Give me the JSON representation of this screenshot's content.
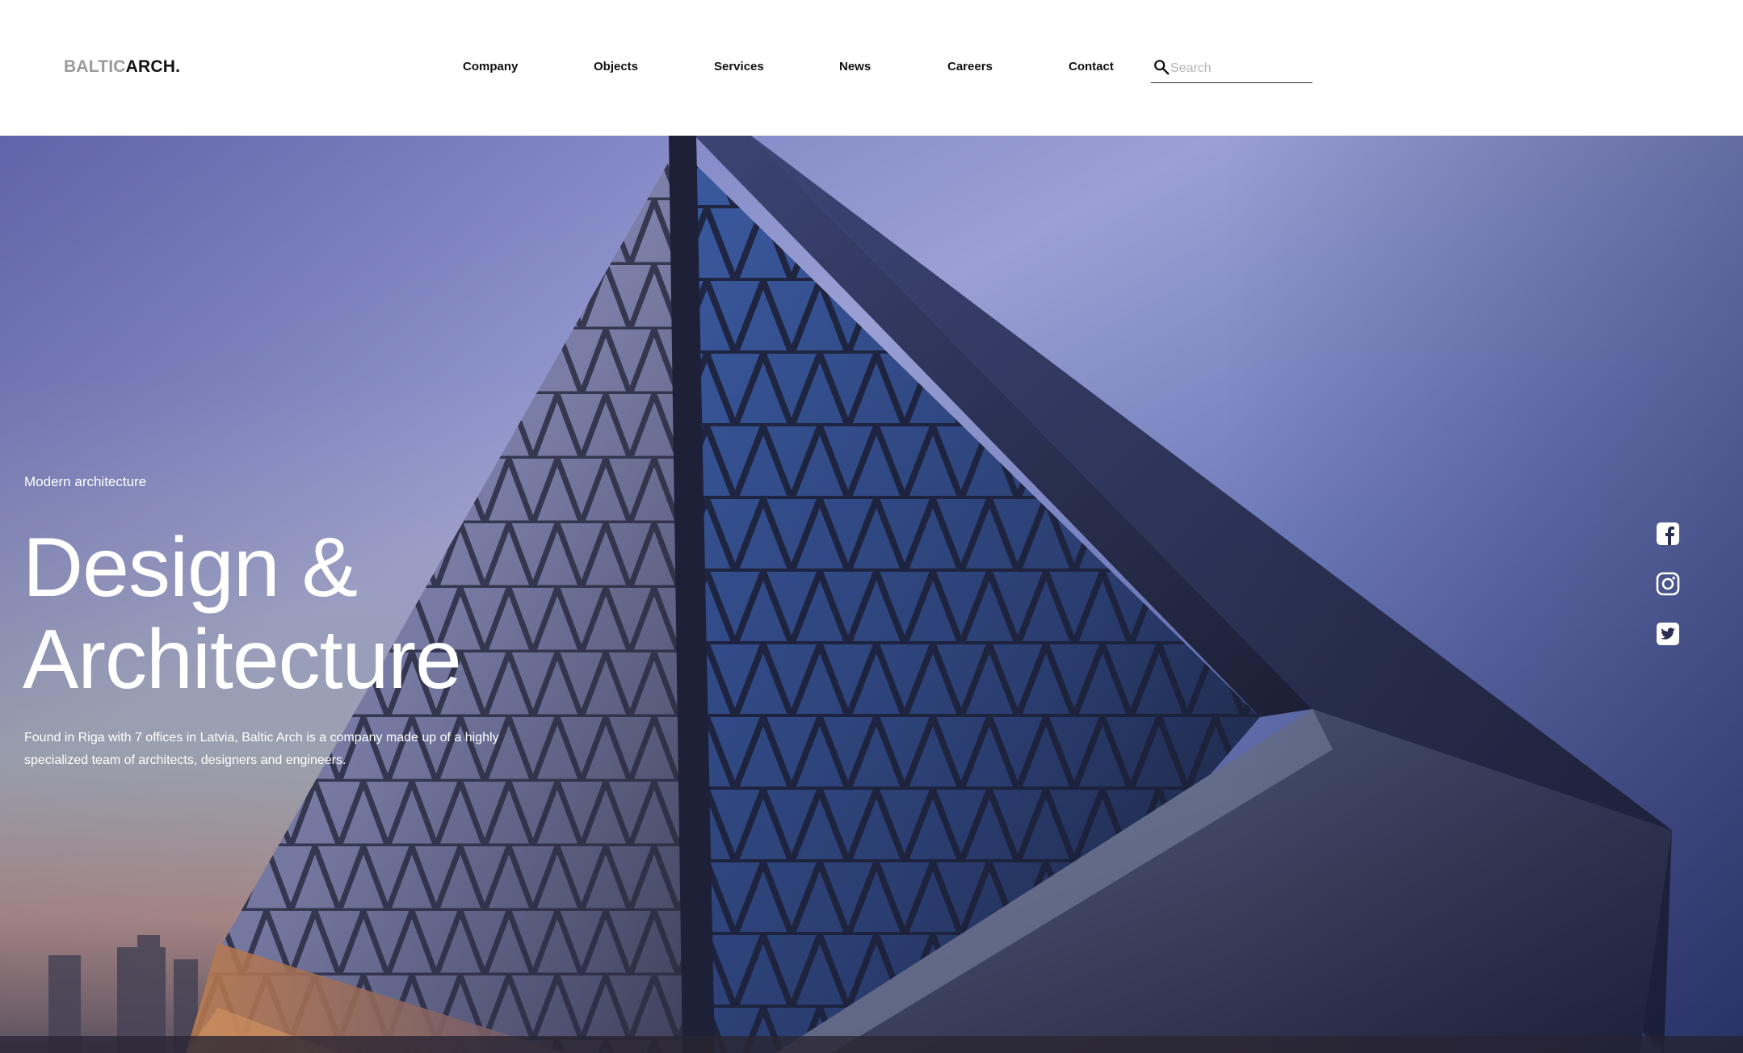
{
  "header": {
    "logo_light": "BALTIC",
    "logo_dark": "ARCH.",
    "nav": [
      {
        "label": "Company"
      },
      {
        "label": "Objects"
      },
      {
        "label": "Services"
      },
      {
        "label": "News"
      },
      {
        "label": "Careers"
      },
      {
        "label": "Contact"
      }
    ],
    "search": {
      "placeholder": "Search",
      "value": "",
      "icon": "search-icon"
    }
  },
  "hero": {
    "eyebrow": "Modern architecture",
    "headline_line1": "Design &",
    "headline_line2": "Architecture",
    "description": "Found in Riga with 7 offices in Latvia, Baltic Arch is a company made up of a highly specialized team of architects, designers and engineers."
  },
  "social": [
    {
      "icon": "facebook-icon"
    },
    {
      "icon": "instagram-icon"
    },
    {
      "icon": "twitter-icon"
    }
  ],
  "colors": {
    "text_dark": "#111111",
    "logo_light": "#9a9a9a",
    "hero_text": "#ffffff",
    "sky_top": "#5f67b3"
  }
}
